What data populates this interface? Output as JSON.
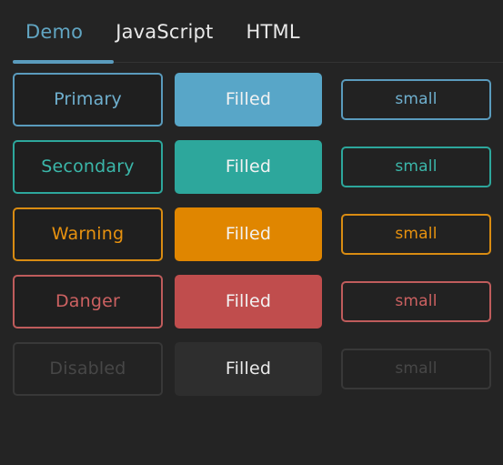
{
  "tabs": [
    {
      "label": "Demo",
      "active": true
    },
    {
      "label": "JavaScript",
      "active": false
    },
    {
      "label": "HTML",
      "active": false
    }
  ],
  "colors": {
    "background": "#242424",
    "primary": "#58a6c8",
    "secondary": "#2da79c",
    "warning": "#e08600",
    "danger": "#c04d4d",
    "disabled": "#2e2e2e",
    "active_tab_text": "#61a5c2",
    "tab_text": "#e9e9e9",
    "filled_text": "#f2f2f2"
  },
  "button_rows": [
    {
      "variant": "primary",
      "outlined_label": "Primary",
      "filled_label": "Filled",
      "small_label": "small"
    },
    {
      "variant": "secondary",
      "outlined_label": "Secondary",
      "filled_label": "Filled",
      "small_label": "small"
    },
    {
      "variant": "warning",
      "outlined_label": "Warning",
      "filled_label": "Filled",
      "small_label": "small"
    },
    {
      "variant": "danger",
      "outlined_label": "Danger",
      "filled_label": "Filled",
      "small_label": "small"
    },
    {
      "variant": "disabled",
      "outlined_label": "Disabled",
      "filled_label": "Filled",
      "small_label": "small"
    }
  ]
}
